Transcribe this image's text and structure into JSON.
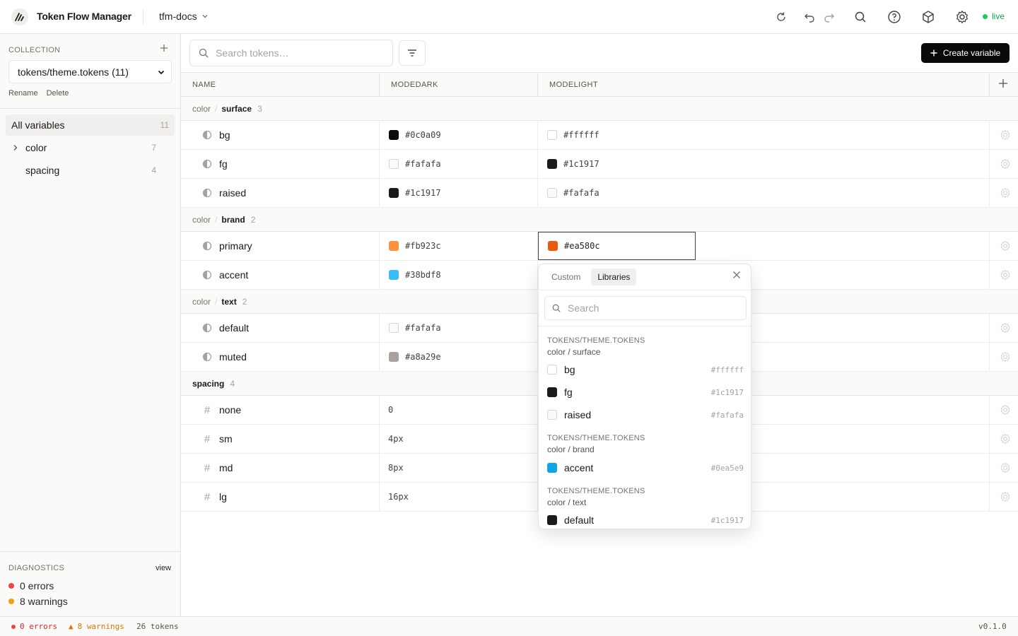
{
  "app": {
    "title": "Token Flow Manager",
    "project": "tfm-docs",
    "live": "live"
  },
  "sidebar": {
    "collection_label": "COLLECTION",
    "collection_value": "tokens/theme.tokens (11)",
    "rename": "Rename",
    "delete": "Delete",
    "items": [
      {
        "label": "All variables",
        "count": "11"
      },
      {
        "label": "color",
        "count": "7"
      },
      {
        "label": "spacing",
        "count": "4"
      }
    ],
    "diagnostics": {
      "label": "DIAGNOSTICS",
      "view": "view",
      "errors": "0 errors",
      "warnings": "8 warnings"
    }
  },
  "toolbar": {
    "search_placeholder": "Search tokens…",
    "create": "Create variable"
  },
  "table": {
    "headers": [
      "NAME",
      "MODEDARK",
      "MODELIGHT"
    ],
    "groups": [
      {
        "prefix": "color",
        "name": "surface",
        "count": "3"
      },
      {
        "prefix": "color",
        "name": "brand",
        "count": "2"
      },
      {
        "prefix": "color",
        "name": "text",
        "count": "2"
      },
      {
        "prefix": "",
        "name": "spacing",
        "count": "4"
      }
    ],
    "rows": [
      {
        "name": "bg",
        "dark": "#0c0a09",
        "light": "#ffffff",
        "dark_color": "#0c0a09",
        "light_color": "#ffffff"
      },
      {
        "name": "fg",
        "dark": "#fafafa",
        "light": "#1c1917",
        "dark_color": "#fafafa",
        "light_color": "#1c1917"
      },
      {
        "name": "raised",
        "dark": "#1c1917",
        "light": "#fafafa",
        "dark_color": "#1c1917",
        "light_color": "#fafafa"
      },
      {
        "name": "primary",
        "dark": "#fb923c",
        "light": "#ea580c",
        "dark_color": "#fb923c",
        "light_color": "#ea580c"
      },
      {
        "name": "accent",
        "dark": "#38bdf8",
        "light": "",
        "dark_color": "#38bdf8",
        "light_color": ""
      },
      {
        "name": "default",
        "dark": "#fafafa",
        "light": "",
        "dark_color": "#fafafa",
        "light_color": ""
      },
      {
        "name": "muted",
        "dark": "#a8a29e",
        "light": "",
        "dark_color": "#a8a29e",
        "light_color": ""
      },
      {
        "name": "none",
        "dark": "0",
        "light": ""
      },
      {
        "name": "sm",
        "dark": "4px",
        "light": ""
      },
      {
        "name": "md",
        "dark": "8px",
        "light": ""
      },
      {
        "name": "lg",
        "dark": "16px",
        "light": ""
      }
    ]
  },
  "popover": {
    "tabs": [
      "Custom",
      "Libraries"
    ],
    "search_placeholder": "Search",
    "groups": [
      {
        "source": "TOKENS/THEME.TOKENS",
        "path": "color / surface",
        "items": [
          {
            "name": "bg",
            "value": "#ffffff",
            "color": "#ffffff"
          },
          {
            "name": "fg",
            "value": "#1c1917",
            "color": "#1c1917"
          },
          {
            "name": "raised",
            "value": "#fafafa",
            "color": "#fafafa"
          }
        ]
      },
      {
        "source": "TOKENS/THEME.TOKENS",
        "path": "color / brand",
        "items": [
          {
            "name": "accent",
            "value": "#0ea5e9",
            "color": "#0ea5e9"
          }
        ]
      },
      {
        "source": "TOKENS/THEME.TOKENS",
        "path": "color / text",
        "items": [
          {
            "name": "default",
            "value": "#1c1917",
            "color": "#1c1917"
          }
        ]
      }
    ]
  },
  "status": {
    "errors": "0 errors",
    "warnings": "8 warnings",
    "tokens": "26 tokens",
    "version": "v0.1.0"
  },
  "colors": {
    "error": "#ef4444",
    "warning": "#f59e0b",
    "live": "#22c55e"
  }
}
